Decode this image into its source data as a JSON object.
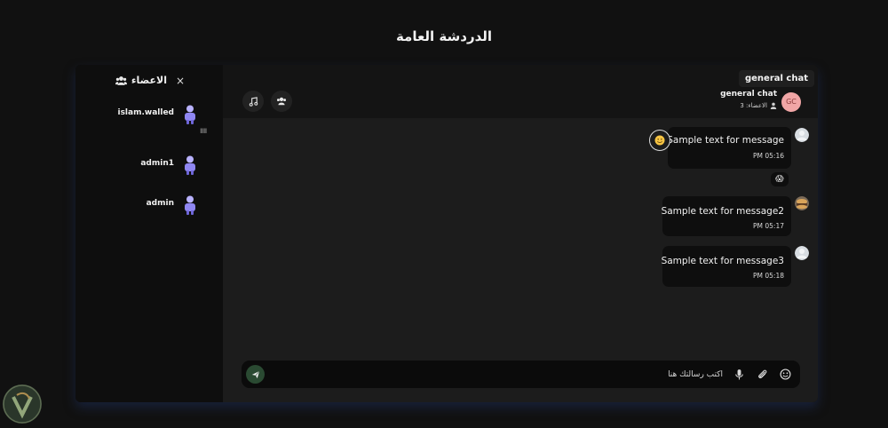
{
  "page": {
    "title": "الدردشة العامة"
  },
  "sidebar": {
    "title": "الاعضاء",
    "close_glyph": "×",
    "members": [
      {
        "name": "islam.walled",
        "subtitle": "llll"
      },
      {
        "name": "admin1",
        "subtitle": ""
      },
      {
        "name": "admin",
        "subtitle": ""
      }
    ]
  },
  "chat": {
    "tag": "general chat",
    "header": {
      "avatar_initials": "GC",
      "name": "general chat",
      "members_count": "الاعضاء: 3"
    },
    "messages": [
      {
        "text": "Sample text for message",
        "time": "PM 05:16",
        "reaction": "😱"
      },
      {
        "text": "Sample text for message2",
        "time": "PM 05:17"
      },
      {
        "text": "Sample text for message3",
        "time": "PM 05:18"
      }
    ],
    "composer": {
      "placeholder": "اكتب رسالتك هنا",
      "value": ""
    }
  },
  "colors": {
    "background": "#111111",
    "panel": "#1c1c1c",
    "bubble": "#0e0e0e",
    "avatar_pink": "#f1a6a6",
    "send_green": "#2a4a32",
    "member_purple": "#8f86f2"
  },
  "icons": {
    "header_buttons": [
      "music-icon",
      "users-icon"
    ],
    "composer": [
      "emoji-icon",
      "attach-icon",
      "mic-icon",
      "send-icon"
    ]
  }
}
